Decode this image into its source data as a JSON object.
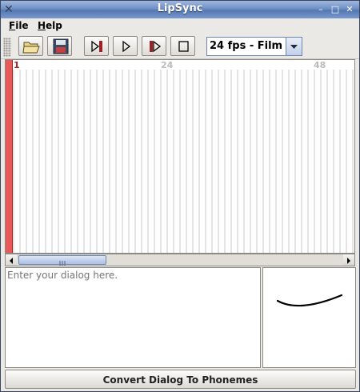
{
  "window": {
    "title": "LipSync",
    "controls": {
      "minimize_icon": "minimize-icon",
      "maximize_icon": "maximize-icon",
      "close_icon": "close-icon"
    }
  },
  "menubar": {
    "file": {
      "mnemonic": "F",
      "rest": "ile"
    },
    "help": {
      "mnemonic": "H",
      "rest": "elp"
    }
  },
  "toolbar": {
    "buttons": [
      {
        "icon": "open-folder-icon"
      },
      {
        "icon": "save-disk-icon"
      },
      {
        "icon": "play-to-marker-icon"
      },
      {
        "icon": "play-icon"
      },
      {
        "icon": "play-from-marker-icon"
      },
      {
        "icon": "stop-icon"
      }
    ],
    "fps_select": {
      "value": "24 fps - Film"
    }
  },
  "timeline": {
    "frame_labels": [
      "1",
      "24",
      "48"
    ],
    "playhead_color": "#e85a5a"
  },
  "dialog": {
    "placeholder": "Enter your dialog here."
  },
  "convert_button": {
    "label": "Convert Dialog To Phonemes"
  },
  "colors": {
    "titlebar": "#6f8fc4",
    "accent": "#9b2323"
  }
}
